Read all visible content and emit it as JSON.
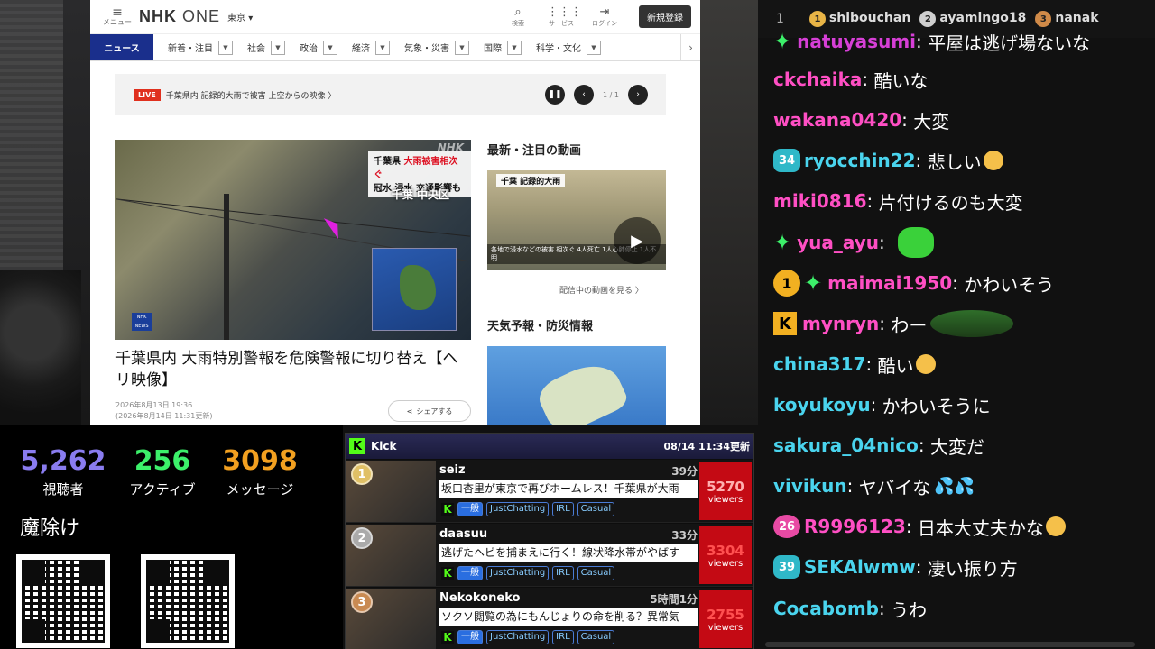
{
  "nhk": {
    "menu_label": "メニュー",
    "logo_main": "NHK",
    "logo_one": "ONE",
    "region": "東京 ▾",
    "tools": [
      {
        "glyph": "⌕",
        "label": "検索"
      },
      {
        "glyph": "⋮⋮⋮",
        "label": "サービス"
      },
      {
        "glyph": "⇥",
        "label": "ログイン"
      }
    ],
    "signup": "新規登録",
    "nav": {
      "active": "ニュース",
      "items": [
        "新着・注目",
        "社会",
        "政治",
        "経済",
        "気象・災害",
        "国際",
        "科学・文化"
      ]
    },
    "live": {
      "tag": "LIVE",
      "text": "千葉県内 記録的大雨で被害 上空からの映像 〉",
      "pager": "1 / 1"
    },
    "hero": {
      "caption_top_1": "千葉県",
      "caption_top_red": "大雨被害相次ぐ",
      "caption_top_2": "冠水 浸水 交通影響も",
      "location": "千葉 中央区",
      "watermark": "NHK",
      "logo": "NHK NEWS"
    },
    "headline": "千葉県内 大雨特別警報を危険警報に切り替え【ヘリ映像】",
    "date_1": "2026年8月13日 19:36",
    "date_2": "(2026年8月14日 11:31更新)",
    "share": "シェアする",
    "latest_title": "最新・注目の動画",
    "latest_thumb_caption": "千葉 記録的大雨",
    "latest_thumb_bar": "各地で浸水などの被害 相次ぐ 4人死亡 1人心肺停止 1人不明",
    "more_link": "配信中の動画を見る 〉",
    "weather_title": "天気予報・防災情報"
  },
  "stats": {
    "items": [
      {
        "value": "5,262",
        "label": "視聴者",
        "color": "#8a7cf0"
      },
      {
        "value": "256",
        "label": "アクティブ",
        "color": "#3cf06a"
      },
      {
        "value": "3098",
        "label": "メッセージ",
        "color": "#f2a020"
      }
    ],
    "charm": "魔除け"
  },
  "kick": {
    "title": "Kick",
    "updated": "08/14 11:34更新",
    "rows": [
      {
        "rank": "1",
        "name": "seiz",
        "time": "39分",
        "desc": "坂口杏里が東京で再びホームレス！千葉県が大雨",
        "general": "一般",
        "tags": [
          "JustChatting",
          "IRL",
          "Casual"
        ],
        "viewers": "5270",
        "viewers_label": "viewers"
      },
      {
        "rank": "2",
        "name": "daasuu",
        "time": "33分",
        "desc": "逃げたヘビを捕まえに行く！線状降水帯がやばす",
        "general": "一般",
        "tags": [
          "JustChatting",
          "IRL",
          "Casual"
        ],
        "viewers": "3304",
        "viewers_label": "viewers"
      },
      {
        "rank": "3",
        "name": "Nekokoneko",
        "time": "5時間1分",
        "desc": "ソクソ閲覧の為にもんじょりの命を削る？異常気",
        "general": "一般",
        "tags": [
          "JustChatting",
          "IRL",
          "Casual"
        ],
        "viewers": "2755",
        "viewers_label": "viewers"
      }
    ]
  },
  "chat": {
    "top": [
      {
        "rank": "1",
        "name": "shibouchan"
      },
      {
        "rank": "2",
        "name": "ayamingo18"
      },
      {
        "rank": "3",
        "name": "nanak"
      }
    ],
    "top_index": "1",
    "messages": [
      {
        "user": "natuyasumi",
        "text": "平屋は逃げ場ないな",
        "color": "#d63fd6"
      },
      {
        "user": "ckchaika",
        "text": "酷いな",
        "color": "#ff4fc4"
      },
      {
        "user": "wakana0420",
        "text": "大変",
        "color": "#ff4fc4"
      },
      {
        "user": "ryocchin22",
        "text": "悲しい",
        "color": "#4ad4ee",
        "sub": "34"
      },
      {
        "user": "miki0816",
        "text": "片付けるのも大変",
        "color": "#ff4fc4"
      },
      {
        "user": "yua_ayu",
        "text": "",
        "color": "#ff4fc4"
      },
      {
        "user": "maimai1950",
        "text": "かわいそう",
        "color": "#ff4fc4",
        "coin": "1"
      },
      {
        "user": "mynryn",
        "text": "わー",
        "color": "#ff4fc4",
        "kbadge": "K"
      },
      {
        "user": "china317",
        "text": "酷い",
        "color": "#4ad4ee"
      },
      {
        "user": "koyukoyu",
        "text": "かわいそうに",
        "color": "#4ad4ee"
      },
      {
        "user": "sakura_04nico",
        "text": "大変だ",
        "color": "#4ad4ee"
      },
      {
        "user": "vivikun",
        "text": "ヤバイな",
        "color": "#4ad4ee"
      },
      {
        "user": "R9996123",
        "text": "日本大丈夫かな",
        "color": "#ff4fc4",
        "sub": "26"
      },
      {
        "user": "SEKAlwmw",
        "text": "凄い振り方",
        "color": "#4ad4ee",
        "sub": "39"
      },
      {
        "user": "Cocabomb",
        "text": "うわ",
        "color": "#4ad4ee"
      }
    ]
  }
}
